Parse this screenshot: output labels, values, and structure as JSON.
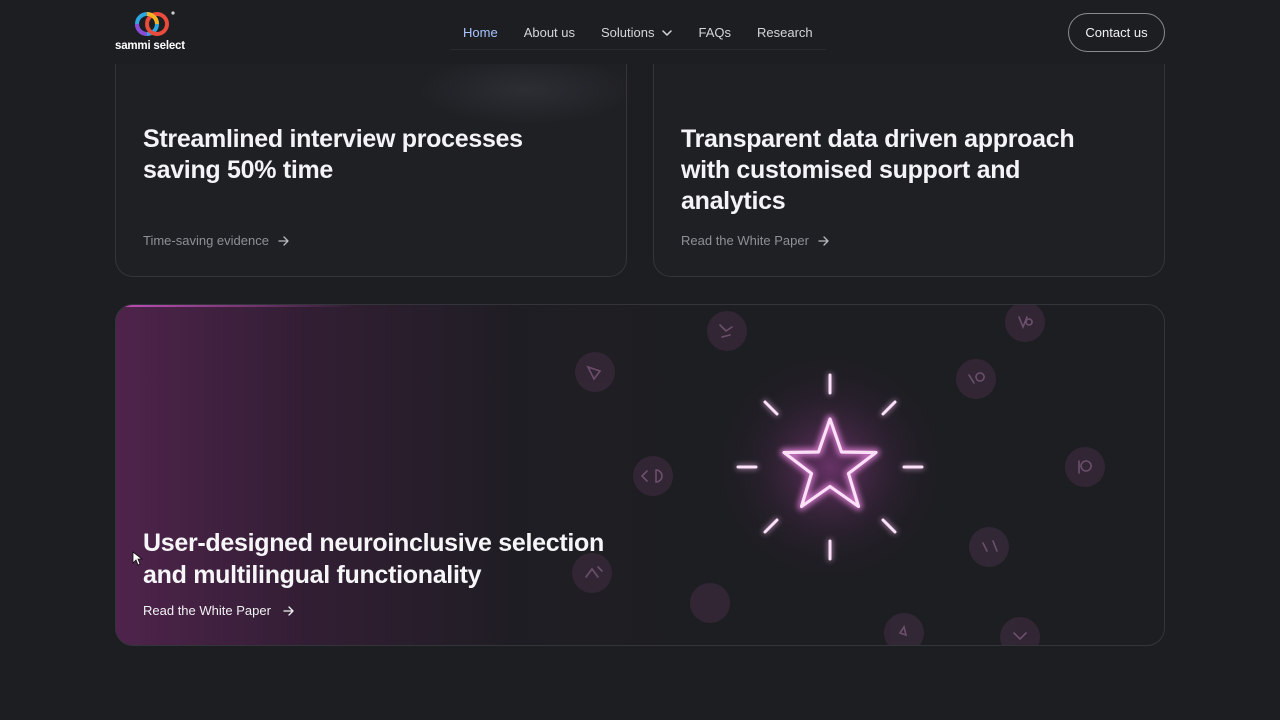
{
  "brand": {
    "name": "sammi select"
  },
  "nav": {
    "items": [
      {
        "label": "Home",
        "active": true
      },
      {
        "label": "About us",
        "active": false
      },
      {
        "label": "Solutions",
        "active": false,
        "has_dropdown": true
      },
      {
        "label": "FAQs",
        "active": false
      },
      {
        "label": "Research",
        "active": false
      }
    ],
    "contact_label": "Contact us"
  },
  "cards": [
    {
      "title": "Streamlined interview processes saving 50% time",
      "link": "Time-saving evidence"
    },
    {
      "title": "Transparent data driven approach with customised support and analytics",
      "link": "Read the White Paper"
    }
  ],
  "feature": {
    "title": "User-designed neuroinclusive selection and multilingual functionality",
    "link": "Read the White Paper",
    "icon": "star-icon"
  },
  "colors": {
    "background": "#1d1e22",
    "nav_active": "#a9c4ff",
    "accent_glow": "#d86ad0",
    "card_border": "#34353b"
  }
}
